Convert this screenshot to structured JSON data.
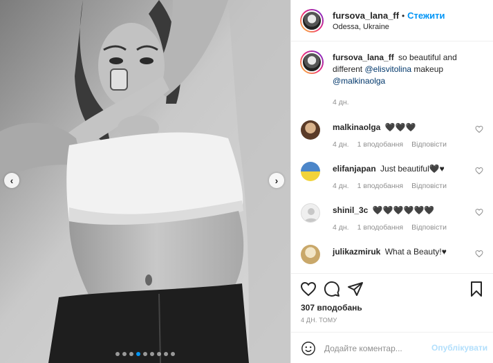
{
  "post": {
    "author": "fursova_lana_ff",
    "follow_label": "Стежити",
    "separator": "•",
    "location": "Odessa, Ukraine",
    "caption": {
      "username": "fursova_lana_ff",
      "text_before": "so beautiful and different",
      "mention_1": "@elisvitolina",
      "text_middle": "makeup",
      "mention_2": "@malkinaolga",
      "time": "4 дн."
    },
    "carousel": {
      "slide_count": 9,
      "active_index": 3,
      "prev_icon": "chevron-left-icon",
      "next_icon": "chevron-right-icon"
    }
  },
  "comments": [
    {
      "username": "malkinaolga",
      "text": "🖤🖤🖤",
      "time": "4 дн.",
      "likes": "1 вподобання",
      "reply": "Відповісти"
    },
    {
      "username": "elifanjapan",
      "text": "Just beautiful🖤♥",
      "time": "4 дн.",
      "likes": "1 вподобання",
      "reply": "Відповісти"
    },
    {
      "username": "shinil_3c",
      "text": "🖤🖤🖤🖤🖤🖤",
      "time": "4 дн.",
      "likes": "1 вподобання",
      "reply": "Відповісти"
    },
    {
      "username": "julikazmiruk",
      "text": "What a Beauty!♥",
      "time": "",
      "likes": "",
      "reply": ""
    }
  ],
  "actions": {
    "like_icon": "heart-icon",
    "comment_icon": "comment-icon",
    "share_icon": "send-icon",
    "save_icon": "bookmark-icon"
  },
  "likes_label": "307 вподобань",
  "posted_time": "4 ДН. ТОМУ",
  "add_comment": {
    "placeholder": "Додайте коментар...",
    "publish_label": "Опублікувати",
    "emoji_icon": "emoji-icon"
  },
  "colors": {
    "accent": "#0095f6",
    "publish_disabled": "#b2dffc",
    "text": "#262626",
    "secondary": "#8e8e8e",
    "mention": "#00376b"
  }
}
